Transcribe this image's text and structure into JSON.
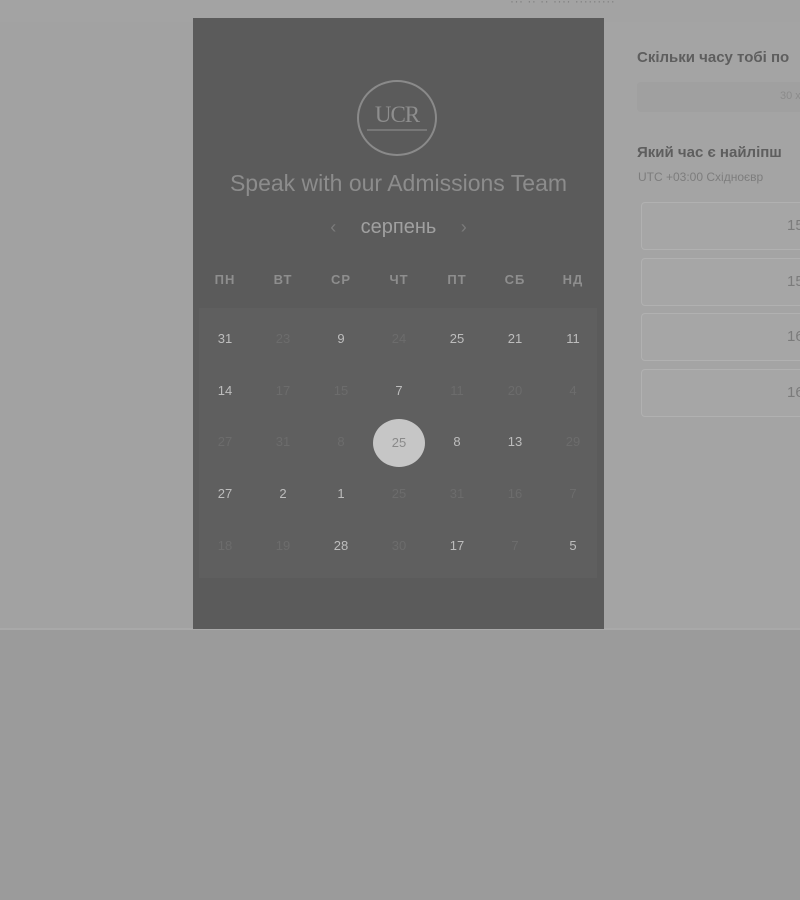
{
  "header": {
    "faint_text": "··· ·· ·· ···· ·········"
  },
  "panel": {
    "logo_text": "UCR",
    "title": "Speak with our Admissions Team",
    "month": "серпень",
    "prev_arrow": "‹",
    "next_arrow": "›",
    "weekdays": [
      "ПН",
      "ВТ",
      "СР",
      "ЧТ",
      "ПТ",
      "СБ",
      "НД"
    ],
    "rows": [
      [
        {
          "d": "31",
          "on": true
        },
        {
          "d": "23",
          "on": false
        },
        {
          "d": "9",
          "on": true
        },
        {
          "d": "24",
          "on": false
        },
        {
          "d": "25",
          "on": true
        },
        {
          "d": "21",
          "on": true
        },
        {
          "d": "11",
          "on": true
        }
      ],
      [
        {
          "d": "14",
          "on": true
        },
        {
          "d": "17",
          "on": false
        },
        {
          "d": "15",
          "on": false
        },
        {
          "d": "7",
          "on": true
        },
        {
          "d": "11",
          "on": false
        },
        {
          "d": "20",
          "on": false
        },
        {
          "d": "4",
          "on": false
        }
      ],
      [
        {
          "d": "27",
          "on": false
        },
        {
          "d": "31",
          "on": false
        },
        {
          "d": "8",
          "on": false
        },
        {
          "d": "25",
          "on": true,
          "selected": true
        },
        {
          "d": "8",
          "on": true
        },
        {
          "d": "13",
          "on": true
        },
        {
          "d": "29",
          "on": false
        }
      ],
      [
        {
          "d": "27",
          "on": true
        },
        {
          "d": "2",
          "on": true
        },
        {
          "d": "1",
          "on": true
        },
        {
          "d": "25",
          "on": false
        },
        {
          "d": "31",
          "on": false
        },
        {
          "d": "16",
          "on": false
        },
        {
          "d": "7",
          "on": false
        }
      ],
      [
        {
          "d": "18",
          "on": false
        },
        {
          "d": "19",
          "on": false
        },
        {
          "d": "28",
          "on": true
        },
        {
          "d": "30",
          "on": false
        },
        {
          "d": "17",
          "on": true
        },
        {
          "d": "7",
          "on": false
        },
        {
          "d": "5",
          "on": true
        }
      ]
    ]
  },
  "right": {
    "duration_heading": "Скільки часу тобі по",
    "duration_value": "30 х",
    "time_heading": "Який час є найліпш",
    "timezone": "UTC +03:00 Східноєвр",
    "slots": [
      "15",
      "15",
      "16",
      "16"
    ]
  },
  "icons": {
    "calendar_prev": "chevron-left-icon",
    "calendar_next": "chevron-right-icon"
  },
  "colors": {
    "panel_bg": "#5b5b5b",
    "selected_day": "#c6c6c6",
    "overlay": "#9b9b9b"
  }
}
